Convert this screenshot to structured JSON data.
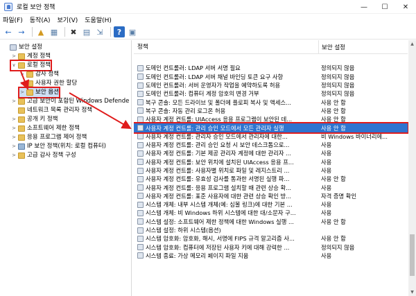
{
  "window": {
    "title": "로컬 보안 정책",
    "minimize": "—",
    "maximize": "☐",
    "close": "✕"
  },
  "menu": [
    "파일(F)",
    "동작(A)",
    "보기(V)",
    "도움말(H)"
  ],
  "toolbar": {
    "back": "←",
    "forward": "→",
    "up": "▲",
    "show_tree": "▦",
    "delete": "✖",
    "properties": "▤",
    "export": "⇲",
    "help": "?",
    "view": "▣"
  },
  "tree": [
    {
      "level": 0,
      "twisty": "",
      "icon": "computer",
      "label": "보안 설정"
    },
    {
      "level": 1,
      "twisty": ">",
      "icon": "folder",
      "label": "계정 정책"
    },
    {
      "level": 1,
      "twisty": "∨",
      "icon": "folder",
      "label": "로컬 정책",
      "highlight": "local"
    },
    {
      "level": 2,
      "twisty": ">",
      "icon": "folder",
      "label": "감사 정책"
    },
    {
      "level": 2,
      "twisty": ">",
      "icon": "folder",
      "label": "사용자 권한 할당"
    },
    {
      "level": 2,
      "twisty": ">",
      "icon": "folder",
      "label": "보안 옵션",
      "highlight": "sec"
    },
    {
      "level": 1,
      "twisty": ">",
      "icon": "folder",
      "label": "고급 보안이 포함된 Windows Defende"
    },
    {
      "level": 1,
      "twisty": "",
      "icon": "folder",
      "label": "네트워크 목록 관리자 정책"
    },
    {
      "level": 1,
      "twisty": ">",
      "icon": "folder",
      "label": "공개 키 정책"
    },
    {
      "level": 1,
      "twisty": ">",
      "icon": "folder",
      "label": "소프트웨어 제한 정책"
    },
    {
      "level": 1,
      "twisty": ">",
      "icon": "folder",
      "label": "응용 프로그램 제어 정책"
    },
    {
      "level": 1,
      "twisty": ">",
      "icon": "shield",
      "label": "IP 보안 정책(위치: 로컬 컴퓨터)"
    },
    {
      "level": 1,
      "twisty": ">",
      "icon": "folder",
      "label": "고급 감사 정책 구성"
    }
  ],
  "table": {
    "headers": {
      "policy": "정책",
      "setting": "보안 설정"
    },
    "rows": [
      {
        "policy": "",
        "setting": ""
      },
      {
        "policy": "도메인 컨트롤러: LDAP 서버 서명 필요",
        "setting": "정의되지 않음"
      },
      {
        "policy": "도메인 컨트롤러: LDAP 서버 채널 바인딩 토큰 요구 사항",
        "setting": "정의되지 않음"
      },
      {
        "policy": "도메인 컨트롤러: 서버 운영자가 작업을 예약하도록 허용",
        "setting": "정의되지 않음"
      },
      {
        "policy": "도메인 컨트롤러: 컴퓨터 계정 암호의 변경 거부",
        "setting": "정의되지 않음"
      },
      {
        "policy": "복구 콘솔: 모든 드라이브 및 폴더에 플로피 복사 및 액세스...",
        "setting": "사용 안 함"
      },
      {
        "policy": "복구 콘솔: 자동 관리 로그온 허용",
        "setting": "사용 안 함"
      },
      {
        "policy": "사용자 계정 컨트롤: UIAccess 응용 프로그램이 보안된 데...",
        "setting": "사용 안 함"
      },
      {
        "policy": "사용자 계정 컨트롤: 관리 승인 모드에서 모든 관리자 실행",
        "setting": "사용 안 함",
        "selected": true
      },
      {
        "policy": "사용자 계정 컨트롤: 관리자 승인 모드에서 관리자에 대한...",
        "setting": "비 Windows 바이너리에..."
      },
      {
        "policy": "사용자 계정 컨트롤: 관리 승인 요청 시 보안 데스크톱으로...",
        "setting": "사용"
      },
      {
        "policy": "사용자 계정 컨트롤: 기본 제공 관리자 계정에 대한 관리자 ...",
        "setting": "사용"
      },
      {
        "policy": "사용자 계정 컨트롤: 보안 위치에 설치된 UIAccess 응용 프...",
        "setting": "사용"
      },
      {
        "policy": "사용자 계정 컨트롤: 사용자별 위치로 파일 및 레지스트리 ...",
        "setting": "사용"
      },
      {
        "policy": "사용자 계정 컨트롤: 유효성 검사를 통과한 서명된 실행 파...",
        "setting": "사용 안 함"
      },
      {
        "policy": "사용자 계정 컨트롤: 응용 프로그램 설치할 때 관련 상승 확...",
        "setting": "사용"
      },
      {
        "policy": "사용자 계정 컨트롤: 표준 사용자에 대한 관련 상승 확인 방...",
        "setting": "자격 증명 확인"
      },
      {
        "policy": "시스템 개체: 내부 시스템 개체(예: 심볼 링크)에 대한 기본 ...",
        "setting": "사용"
      },
      {
        "policy": "시스템 개체: 비 Windows 하위 시스템에 대한 대/소문자 구...",
        "setting": "사용"
      },
      {
        "policy": "시스템 설정: 소프트웨어 제한 정책에 대한 Windows 실행 ...",
        "setting": "사용 안 함"
      },
      {
        "policy": "시스템 설정: 하위 시스템(옵션)",
        "setting": ""
      },
      {
        "policy": "시스템 암호화: 암호화, 해시, 서명에 FIPS 규격 알고리즘 사...",
        "setting": "사용 안 함"
      },
      {
        "policy": "시스템 암호화: 컴퓨터에 저장된 사용자 키에 대해 강력한 ...",
        "setting": "정의되지 않음"
      },
      {
        "policy": "시스템 종료: 가상 메모리 페이지 파일 지움",
        "setting": "사용"
      }
    ]
  },
  "colors": {
    "selection": "#2f74d0",
    "annotation": "#e01b1b"
  }
}
